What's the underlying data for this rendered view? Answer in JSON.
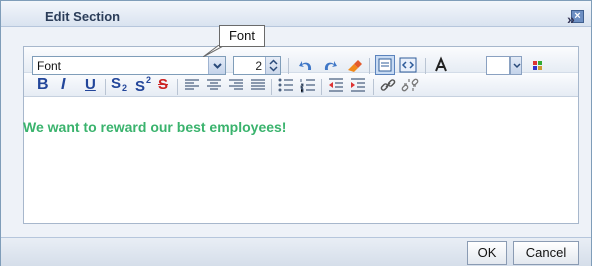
{
  "dialog": {
    "title": "Edit Section",
    "close_symbol": "×"
  },
  "tooltip": {
    "text": "Font"
  },
  "toolbar": {
    "font_select": {
      "value": "Font"
    },
    "font_size": {
      "value": "2"
    },
    "more_symbol": "»",
    "text_color": "#ffffff",
    "format": {
      "bold": "B",
      "italic": "I",
      "underline": "U",
      "subscript": "S",
      "superscript": "S",
      "strikethrough": "S"
    }
  },
  "editor": {
    "content_text": "We want to reward our best employees!",
    "content_color": "#3ab36d"
  },
  "footer": {
    "ok_label": "OK",
    "cancel_label": "Cancel"
  },
  "icons": [
    "undo-icon",
    "redo-icon",
    "eraser-icon",
    "design-view-icon",
    "html-view-icon",
    "font-color-icon",
    "table-icon",
    "align-left-icon",
    "align-center-icon",
    "align-right-icon",
    "justify-icon",
    "bullet-list-icon",
    "numbered-list-icon",
    "outdent-icon",
    "indent-icon",
    "link-icon",
    "unlink-icon"
  ]
}
